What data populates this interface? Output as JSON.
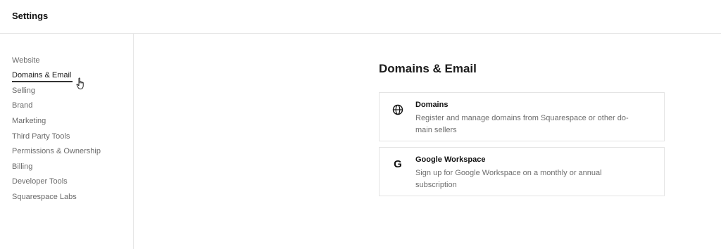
{
  "header": {
    "title": "Settings"
  },
  "sidebar": {
    "items": [
      {
        "label": "Website"
      },
      {
        "label": "Domains & Email"
      },
      {
        "label": "Selling"
      },
      {
        "label": "Brand"
      },
      {
        "label": "Marketing"
      },
      {
        "label": "Third Party Tools"
      },
      {
        "label": "Permissions & Ownership"
      },
      {
        "label": "Billing"
      },
      {
        "label": "Developer Tools"
      },
      {
        "label": "Squarespace Labs"
      }
    ],
    "active_item": "Domains & Email"
  },
  "main": {
    "title": "Domains & Email",
    "cards": [
      {
        "icon": "globe-icon",
        "title": "Domains",
        "description_line1": "Register and manage domains from Squarespace or other do-",
        "description_line2": "main sellers"
      },
      {
        "icon": "google-g-icon",
        "title": "Google Workspace",
        "description_line1": "Sign up for Google Workspace on a monthly or annual",
        "description_line2": "subscription"
      }
    ]
  }
}
